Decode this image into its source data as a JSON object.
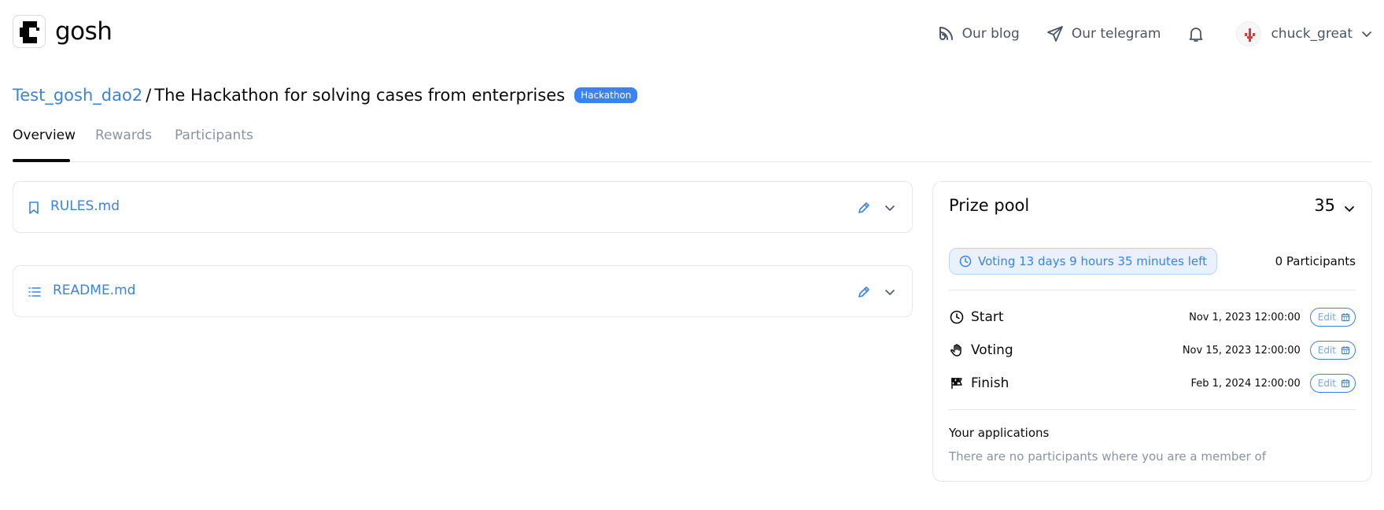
{
  "header": {
    "logo_text": "gosh",
    "nav": [
      {
        "label": "Our blog",
        "icon": "rss-icon"
      },
      {
        "label": "Our telegram",
        "icon": "send-icon"
      }
    ],
    "notifications_icon": "bell-icon",
    "user": {
      "name": "chuck_great",
      "avatar": "avatar-icon"
    }
  },
  "title": {
    "dao": "Test_gosh_dao2",
    "separator": "/",
    "name": "The Hackathon for solving cases from enterprises",
    "badge": "Hackathon"
  },
  "tabs": [
    {
      "label": "Overview",
      "active": true
    },
    {
      "label": "Rewards",
      "active": false
    },
    {
      "label": "Participants",
      "active": false
    }
  ],
  "files": [
    {
      "name": "RULES.md",
      "icon": "bookmark-icon"
    },
    {
      "name": "README.md",
      "icon": "list-icon"
    }
  ],
  "prize_pool": {
    "title": "Prize pool",
    "amount": "35",
    "voting_status": "Voting 13 days 9 hours 35 minutes left",
    "participants": "0 Participants",
    "stages": [
      {
        "label": "Start",
        "date": "Nov 1, 2023 12:00:00",
        "edit": "Edit",
        "icon": "clock-icon"
      },
      {
        "label": "Voting",
        "date": "Nov 15, 2023 12:00:00",
        "edit": "Edit",
        "icon": "hand-icon"
      },
      {
        "label": "Finish",
        "date": "Feb 1, 2024 12:00:00",
        "edit": "Edit",
        "icon": "flag-icon"
      }
    ],
    "applications_title": "Your applications",
    "applications_empty": "There are no participants where you are a member of"
  },
  "colors": {
    "accent": "#3b82e5",
    "badge": "#3b82f6",
    "muted": "#8a93a3",
    "border": "#e5e7eb"
  }
}
